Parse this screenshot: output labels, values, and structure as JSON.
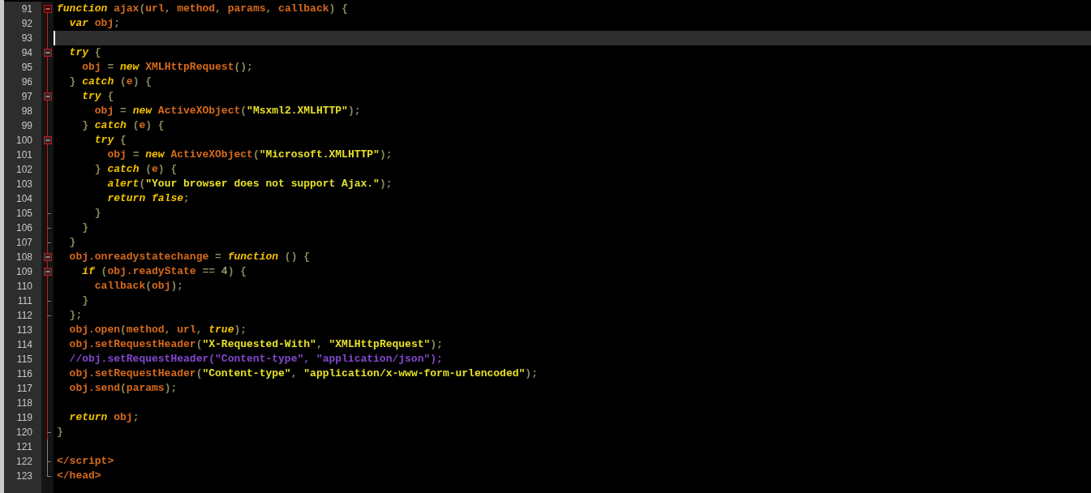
{
  "editor": {
    "lines": [
      {
        "number": "91",
        "fold": {
          "kind": "head"
        },
        "current": false,
        "tokens": [
          {
            "text": "function ",
            "kind": "kw"
          },
          {
            "text": "ajax",
            "kind": "id"
          },
          {
            "text": "(",
            "kind": "p"
          },
          {
            "text": "url",
            "kind": "id"
          },
          {
            "text": ", ",
            "kind": "p"
          },
          {
            "text": "method",
            "kind": "id"
          },
          {
            "text": ", ",
            "kind": "p"
          },
          {
            "text": "params",
            "kind": "id"
          },
          {
            "text": ", ",
            "kind": "p"
          },
          {
            "text": "callback",
            "kind": "id"
          },
          {
            "text": ") {",
            "kind": "p"
          }
        ]
      },
      {
        "number": "92",
        "fold": {
          "kind": "line"
        },
        "current": false,
        "tokens": [
          {
            "text": "  var ",
            "kind": "kw"
          },
          {
            "text": "obj",
            "kind": "id"
          },
          {
            "text": ";",
            "kind": "p"
          }
        ]
      },
      {
        "number": "93",
        "fold": {
          "kind": "line"
        },
        "current": true
      },
      {
        "number": "94",
        "fold": {
          "kind": "open"
        },
        "current": false,
        "tokens": [
          {
            "text": "  try",
            "kind": "kw"
          },
          {
            "text": " {",
            "kind": "p"
          }
        ]
      },
      {
        "number": "95",
        "fold": {
          "kind": "line"
        },
        "current": false,
        "tokens": [
          {
            "text": "    obj",
            "kind": "id"
          },
          {
            "text": " = ",
            "kind": "p"
          },
          {
            "text": "new ",
            "kind": "kw"
          },
          {
            "text": "XMLHttpRequest",
            "kind": "id"
          },
          {
            "text": "();",
            "kind": "p"
          }
        ]
      },
      {
        "number": "96",
        "fold": {
          "kind": "line"
        },
        "current": false,
        "tokens": [
          {
            "text": "  } ",
            "kind": "p"
          },
          {
            "text": "catch",
            "kind": "kw"
          },
          {
            "text": " (",
            "kind": "p"
          },
          {
            "text": "e",
            "kind": "id"
          },
          {
            "text": ") {",
            "kind": "p"
          }
        ]
      },
      {
        "number": "97",
        "fold": {
          "kind": "open"
        },
        "current": false,
        "tokens": [
          {
            "text": "    try",
            "kind": "kw"
          },
          {
            "text": " {",
            "kind": "p"
          }
        ]
      },
      {
        "number": "98",
        "fold": {
          "kind": "line"
        },
        "current": false,
        "tokens": [
          {
            "text": "      obj",
            "kind": "id"
          },
          {
            "text": " = ",
            "kind": "p"
          },
          {
            "text": "new ",
            "kind": "kw"
          },
          {
            "text": "ActiveXObject",
            "kind": "id"
          },
          {
            "text": "(",
            "kind": "p"
          },
          {
            "text": "\"Msxml2.XMLHTTP\"",
            "kind": "str"
          },
          {
            "text": ");",
            "kind": "p"
          }
        ]
      },
      {
        "number": "99",
        "fold": {
          "kind": "line"
        },
        "current": false,
        "tokens": [
          {
            "text": "    } ",
            "kind": "p"
          },
          {
            "text": "catch",
            "kind": "kw"
          },
          {
            "text": " (",
            "kind": "p"
          },
          {
            "text": "e",
            "kind": "id"
          },
          {
            "text": ") {",
            "kind": "p"
          }
        ]
      },
      {
        "number": "100",
        "fold": {
          "kind": "open"
        },
        "current": false,
        "tokens": [
          {
            "text": "      try",
            "kind": "kw"
          },
          {
            "text": " {",
            "kind": "p"
          }
        ]
      },
      {
        "number": "101",
        "fold": {
          "kind": "line"
        },
        "current": false,
        "tokens": [
          {
            "text": "        obj",
            "kind": "id"
          },
          {
            "text": " = ",
            "kind": "p"
          },
          {
            "text": "new ",
            "kind": "kw"
          },
          {
            "text": "ActiveXObject",
            "kind": "id"
          },
          {
            "text": "(",
            "kind": "p"
          },
          {
            "text": "\"Microsoft.XMLHTTP\"",
            "kind": "str"
          },
          {
            "text": ");",
            "kind": "p"
          }
        ]
      },
      {
        "number": "102",
        "fold": {
          "kind": "line"
        },
        "current": false,
        "tokens": [
          {
            "text": "      } ",
            "kind": "p"
          },
          {
            "text": "catch",
            "kind": "kw"
          },
          {
            "text": " (",
            "kind": "p"
          },
          {
            "text": "e",
            "kind": "id"
          },
          {
            "text": ") {",
            "kind": "p"
          }
        ]
      },
      {
        "number": "103",
        "fold": {
          "kind": "line"
        },
        "current": false,
        "tokens": [
          {
            "text": "        alert",
            "kind": "kw"
          },
          {
            "text": "(",
            "kind": "p"
          },
          {
            "text": "\"Your browser does not support Ajax.\"",
            "kind": "str"
          },
          {
            "text": ");",
            "kind": "p"
          }
        ]
      },
      {
        "number": "104",
        "fold": {
          "kind": "line"
        },
        "current": false,
        "tokens": [
          {
            "text": "        return false",
            "kind": "kw"
          },
          {
            "text": ";",
            "kind": "p"
          }
        ]
      },
      {
        "number": "105",
        "fold": {
          "kind": "end"
        },
        "current": false,
        "tokens": [
          {
            "text": "      }",
            "kind": "p"
          }
        ]
      },
      {
        "number": "106",
        "fold": {
          "kind": "end"
        },
        "current": false,
        "tokens": [
          {
            "text": "    }",
            "kind": "p"
          }
        ]
      },
      {
        "number": "107",
        "fold": {
          "kind": "end"
        },
        "current": false,
        "tokens": [
          {
            "text": "  }",
            "kind": "p"
          }
        ]
      },
      {
        "number": "108",
        "fold": {
          "kind": "open"
        },
        "current": false,
        "tokens": [
          {
            "text": "  obj.onreadystatechange",
            "kind": "id"
          },
          {
            "text": " = ",
            "kind": "p"
          },
          {
            "text": "function",
            "kind": "kw"
          },
          {
            "text": " () {",
            "kind": "p"
          }
        ]
      },
      {
        "number": "109",
        "fold": {
          "kind": "open"
        },
        "current": false,
        "tokens": [
          {
            "text": "    if",
            "kind": "kw"
          },
          {
            "text": " (",
            "kind": "p"
          },
          {
            "text": "obj.readyState",
            "kind": "id"
          },
          {
            "text": " == ",
            "kind": "p"
          },
          {
            "text": "4",
            "kind": "num"
          },
          {
            "text": ") {",
            "kind": "p"
          }
        ]
      },
      {
        "number": "110",
        "fold": {
          "kind": "line"
        },
        "current": false,
        "tokens": [
          {
            "text": "      callback",
            "kind": "id"
          },
          {
            "text": "(",
            "kind": "p"
          },
          {
            "text": "obj",
            "kind": "id"
          },
          {
            "text": ");",
            "kind": "p"
          }
        ]
      },
      {
        "number": "111",
        "fold": {
          "kind": "end"
        },
        "current": false,
        "tokens": [
          {
            "text": "    }",
            "kind": "p"
          }
        ]
      },
      {
        "number": "112",
        "fold": {
          "kind": "end"
        },
        "current": false,
        "tokens": [
          {
            "text": "  };",
            "kind": "p"
          }
        ]
      },
      {
        "number": "113",
        "fold": {
          "kind": "line"
        },
        "current": false,
        "tokens": [
          {
            "text": "  obj.open",
            "kind": "id"
          },
          {
            "text": "(",
            "kind": "p"
          },
          {
            "text": "method",
            "kind": "id"
          },
          {
            "text": ", ",
            "kind": "p"
          },
          {
            "text": "url",
            "kind": "id"
          },
          {
            "text": ", ",
            "kind": "p"
          },
          {
            "text": "true",
            "kind": "kw"
          },
          {
            "text": ");",
            "kind": "p"
          }
        ]
      },
      {
        "number": "114",
        "fold": {
          "kind": "line"
        },
        "current": false,
        "tokens": [
          {
            "text": "  obj.setRequestHeader",
            "kind": "id"
          },
          {
            "text": "(",
            "kind": "p"
          },
          {
            "text": "\"X-Requested-With\"",
            "kind": "str"
          },
          {
            "text": ", ",
            "kind": "p"
          },
          {
            "text": "\"XMLHttpRequest\"",
            "kind": "str"
          },
          {
            "text": ");",
            "kind": "p"
          }
        ]
      },
      {
        "number": "115",
        "fold": {
          "kind": "line"
        },
        "current": false,
        "tokens": [
          {
            "text": "  //obj.setRequestHeader(\"Content-type\", \"application/json\");",
            "kind": "cmt"
          }
        ]
      },
      {
        "number": "116",
        "fold": {
          "kind": "line"
        },
        "current": false,
        "tokens": [
          {
            "text": "  obj.setRequestHeader",
            "kind": "id"
          },
          {
            "text": "(",
            "kind": "p"
          },
          {
            "text": "\"Content-type\"",
            "kind": "str"
          },
          {
            "text": ", ",
            "kind": "p"
          },
          {
            "text": "\"application/x-www-form-urlencoded\"",
            "kind": "str"
          },
          {
            "text": ");",
            "kind": "p"
          }
        ]
      },
      {
        "number": "117",
        "fold": {
          "kind": "line"
        },
        "current": false,
        "tokens": [
          {
            "text": "  obj.send",
            "kind": "id"
          },
          {
            "text": "(",
            "kind": "p"
          },
          {
            "text": "params",
            "kind": "id"
          },
          {
            "text": ");",
            "kind": "p"
          }
        ]
      },
      {
        "number": "118",
        "fold": {
          "kind": "line"
        },
        "current": false
      },
      {
        "number": "119",
        "fold": {
          "kind": "line"
        },
        "current": false,
        "tokens": [
          {
            "text": "  return ",
            "kind": "kw"
          },
          {
            "text": "obj",
            "kind": "id"
          },
          {
            "text": ";",
            "kind": "p"
          }
        ]
      },
      {
        "number": "120",
        "fold": {
          "kind": "end"
        },
        "current": false,
        "tokens": [
          {
            "text": "}",
            "kind": "p"
          }
        ]
      },
      {
        "number": "121",
        "fold": {
          "kind": "outer"
        },
        "current": false
      },
      {
        "number": "122",
        "fold": {
          "kind": "outer-end"
        },
        "current": false,
        "tokens": [
          {
            "text": "</script>",
            "kind": "tag"
          }
        ]
      },
      {
        "number": "123",
        "fold": {
          "kind": "last"
        },
        "current": false,
        "tokens": [
          {
            "text": "</head>",
            "kind": "tag"
          }
        ]
      }
    ]
  }
}
